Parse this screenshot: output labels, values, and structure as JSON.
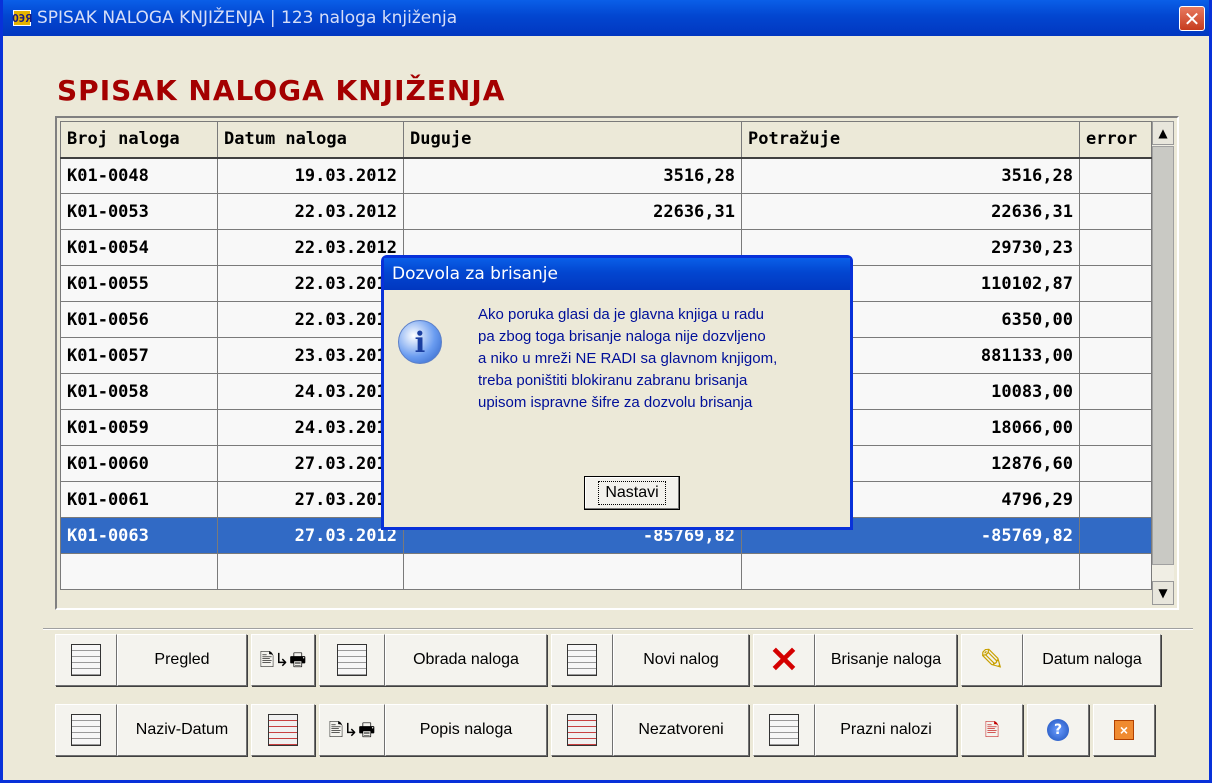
{
  "window": {
    "app_icon_text": "ОЭЯ",
    "title": "SPISAK NALOGA KNJIŽENJA  | 123 naloga knjiženja",
    "close_symbol": "✕"
  },
  "page": {
    "heading": "SPISAK NALOGA KNJIŽENJA"
  },
  "grid": {
    "columns": [
      "Broj naloga",
      "Datum naloga",
      "Duguje",
      "Potražuje",
      "error"
    ],
    "rows": [
      [
        "K01-0048",
        "19.03.2012",
        "3516,28",
        "3516,28",
        ""
      ],
      [
        "K01-0053",
        "22.03.2012",
        "22636,31",
        "22636,31",
        ""
      ],
      [
        "K01-0054",
        "22.03.2012",
        "",
        "29730,23",
        ""
      ],
      [
        "K01-0055",
        "22.03.2012",
        "",
        "110102,87",
        ""
      ],
      [
        "K01-0056",
        "22.03.2012",
        "",
        "6350,00",
        ""
      ],
      [
        "K01-0057",
        "23.03.2012",
        "",
        "881133,00",
        ""
      ],
      [
        "K01-0058",
        "24.03.2012",
        "",
        "10083,00",
        ""
      ],
      [
        "K01-0059",
        "24.03.2012",
        "",
        "18066,00",
        ""
      ],
      [
        "K01-0060",
        "27.03.2012",
        "",
        "12876,60",
        ""
      ],
      [
        "K01-0061",
        "27.03.2012",
        "",
        "4796,29",
        ""
      ],
      [
        "K01-0063",
        "27.03.2012",
        "-85769,82",
        "-85769,82",
        ""
      ]
    ],
    "selected_row": 10
  },
  "toolbar": {
    "pregled": "Pregled",
    "obrada_naloga": "Obrada naloga",
    "novi_nalog": "Novi nalog",
    "brisanje_naloga": "Brisanje naloga",
    "datum_naloga": "Datum naloga",
    "naziv_datum": "Naziv-Datum",
    "popis_naloga": "Popis naloga",
    "nezatvoreni": "Nezatvoreni",
    "prazni_nalozi": "Prazni nalozi"
  },
  "dialog": {
    "title": "Dozvola za brisanje",
    "lines": [
      "Ako poruka glasi da je glavna knjiga u radu",
      "pa zbog toga brisanje naloga nije dozvljeno",
      "a niko u mreži NE RADI sa glavnom knjigom,",
      "treba poništiti blokiranu zabranu brisanja",
      "upisom ispravne šifre za dozvolu brisanja"
    ],
    "button": "Nastavi"
  },
  "icons": {
    "info": "i",
    "help": "?",
    "exit": "×",
    "scroll_up": "▲",
    "scroll_down": "▼"
  }
}
